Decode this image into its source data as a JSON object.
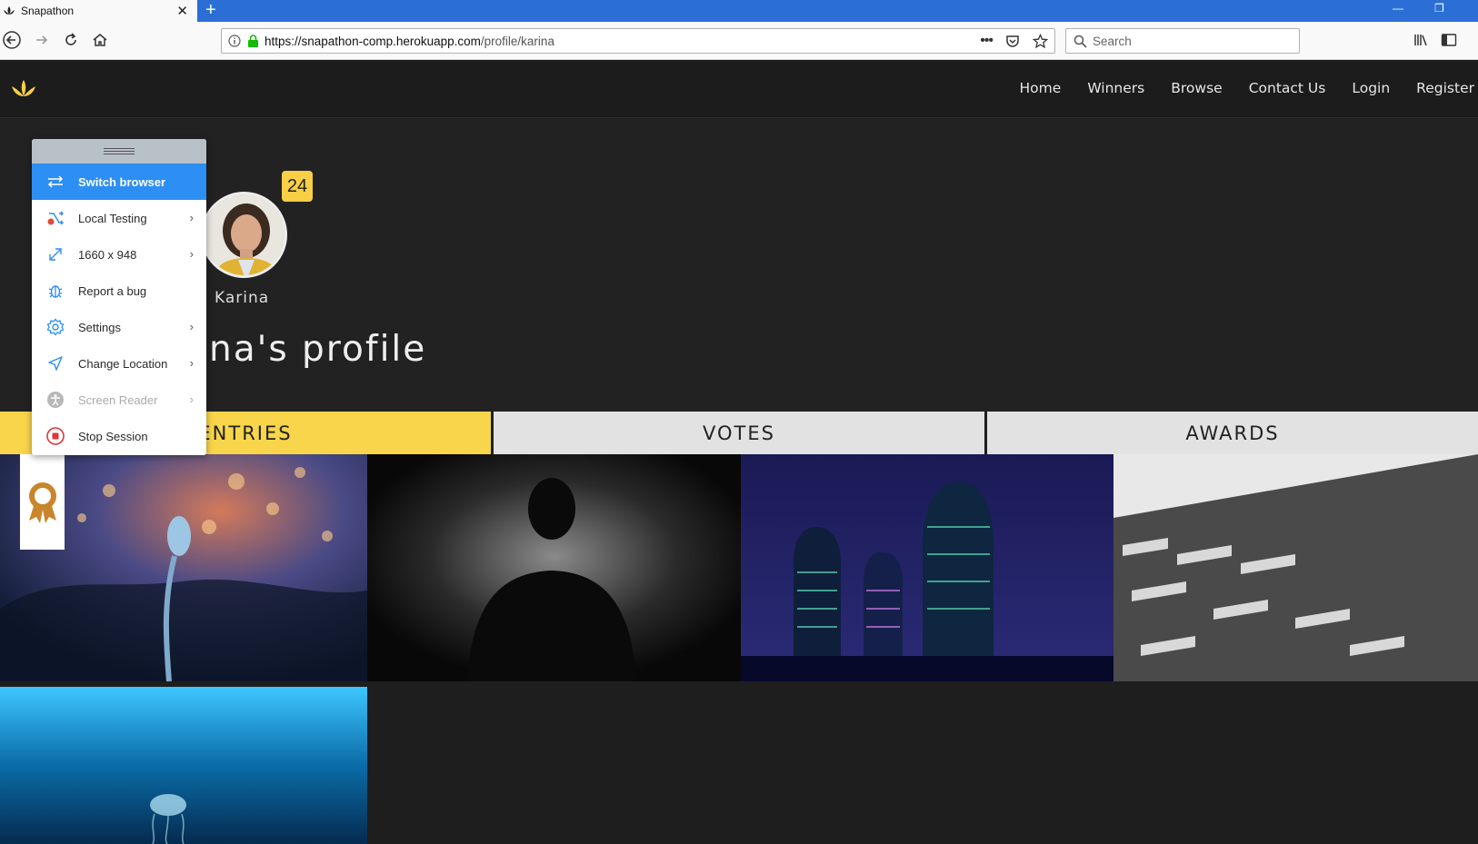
{
  "browser": {
    "tab_title": "Snapathon",
    "tab_close": "✕",
    "new_tab": "+",
    "url_host": "https://snapathon-comp.herokuapp.com",
    "url_path": "/profile/karina",
    "search_placeholder": "Search"
  },
  "site": {
    "nav": [
      "Home",
      "Winners",
      "Browse",
      "Contact Us",
      "Login",
      "Register"
    ],
    "badge_count": "24",
    "profile_name": "Karina",
    "profile_title": "na's profile",
    "tabs": [
      "ENTRIES",
      "VOTES",
      "AWARDS"
    ]
  },
  "panel": {
    "items": [
      {
        "label": "Switch browser",
        "icon": "switch-icon"
      },
      {
        "label": "Local Testing",
        "icon": "local-testing-icon"
      },
      {
        "label": "1660 x 948",
        "icon": "resolution-icon"
      },
      {
        "label": "Report a bug",
        "icon": "bug-icon"
      },
      {
        "label": "Settings",
        "icon": "gear-icon"
      },
      {
        "label": "Change Location",
        "icon": "location-icon"
      },
      {
        "label": "Screen Reader",
        "icon": "accessibility-icon"
      },
      {
        "label": "Stop Session",
        "icon": "stop-icon"
      }
    ],
    "chevron": "›"
  },
  "colors": {
    "accent": "#f8d54a",
    "panel_active": "#2d8ef3",
    "browser_blue": "#2b6fd6"
  }
}
